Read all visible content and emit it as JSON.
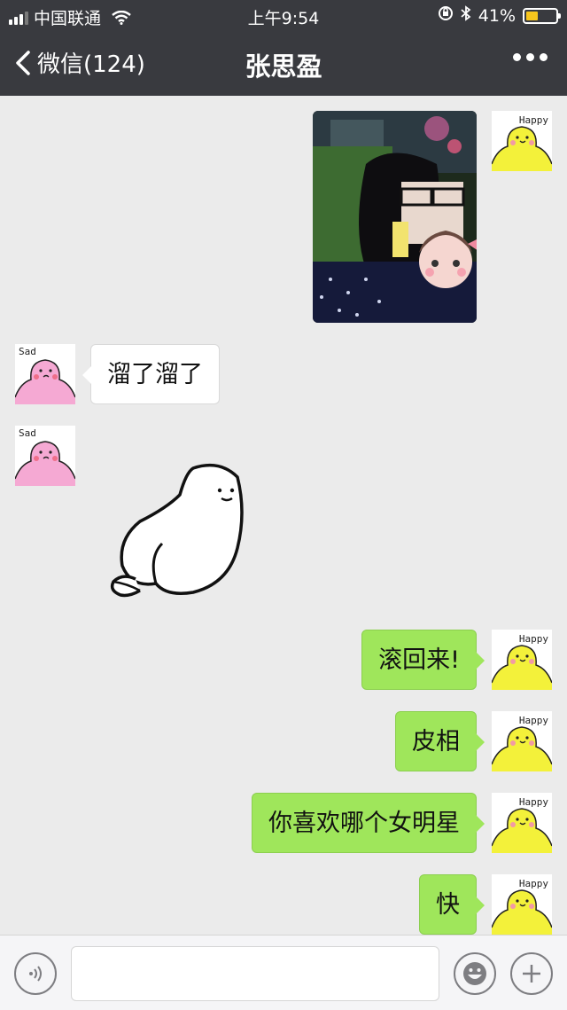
{
  "status_bar": {
    "carrier": "中国联通",
    "time": "上午9:54",
    "battery_percent": "41%",
    "battery_level": 0.41
  },
  "nav": {
    "back_label": "微信(124)",
    "title": "张思盈"
  },
  "avatars": {
    "me_caption": "Happy",
    "other_caption": "Sad"
  },
  "messages": [
    {
      "from": "me",
      "type": "image"
    },
    {
      "from": "other",
      "type": "text",
      "text": "溜了溜了"
    },
    {
      "from": "other",
      "type": "sticker"
    },
    {
      "from": "me",
      "type": "text",
      "text": "滚回来!"
    },
    {
      "from": "me",
      "type": "text",
      "text": "皮相"
    },
    {
      "from": "me",
      "type": "text",
      "text": "你喜欢哪个女明星"
    },
    {
      "from": "me",
      "type": "text",
      "text": "快"
    }
  ],
  "input_bar": {
    "placeholder": ""
  },
  "colors": {
    "nav_background": "#393a3f",
    "chat_background": "#ebebeb",
    "my_bubble": "#9fe65b",
    "other_bubble": "#ffffff"
  }
}
